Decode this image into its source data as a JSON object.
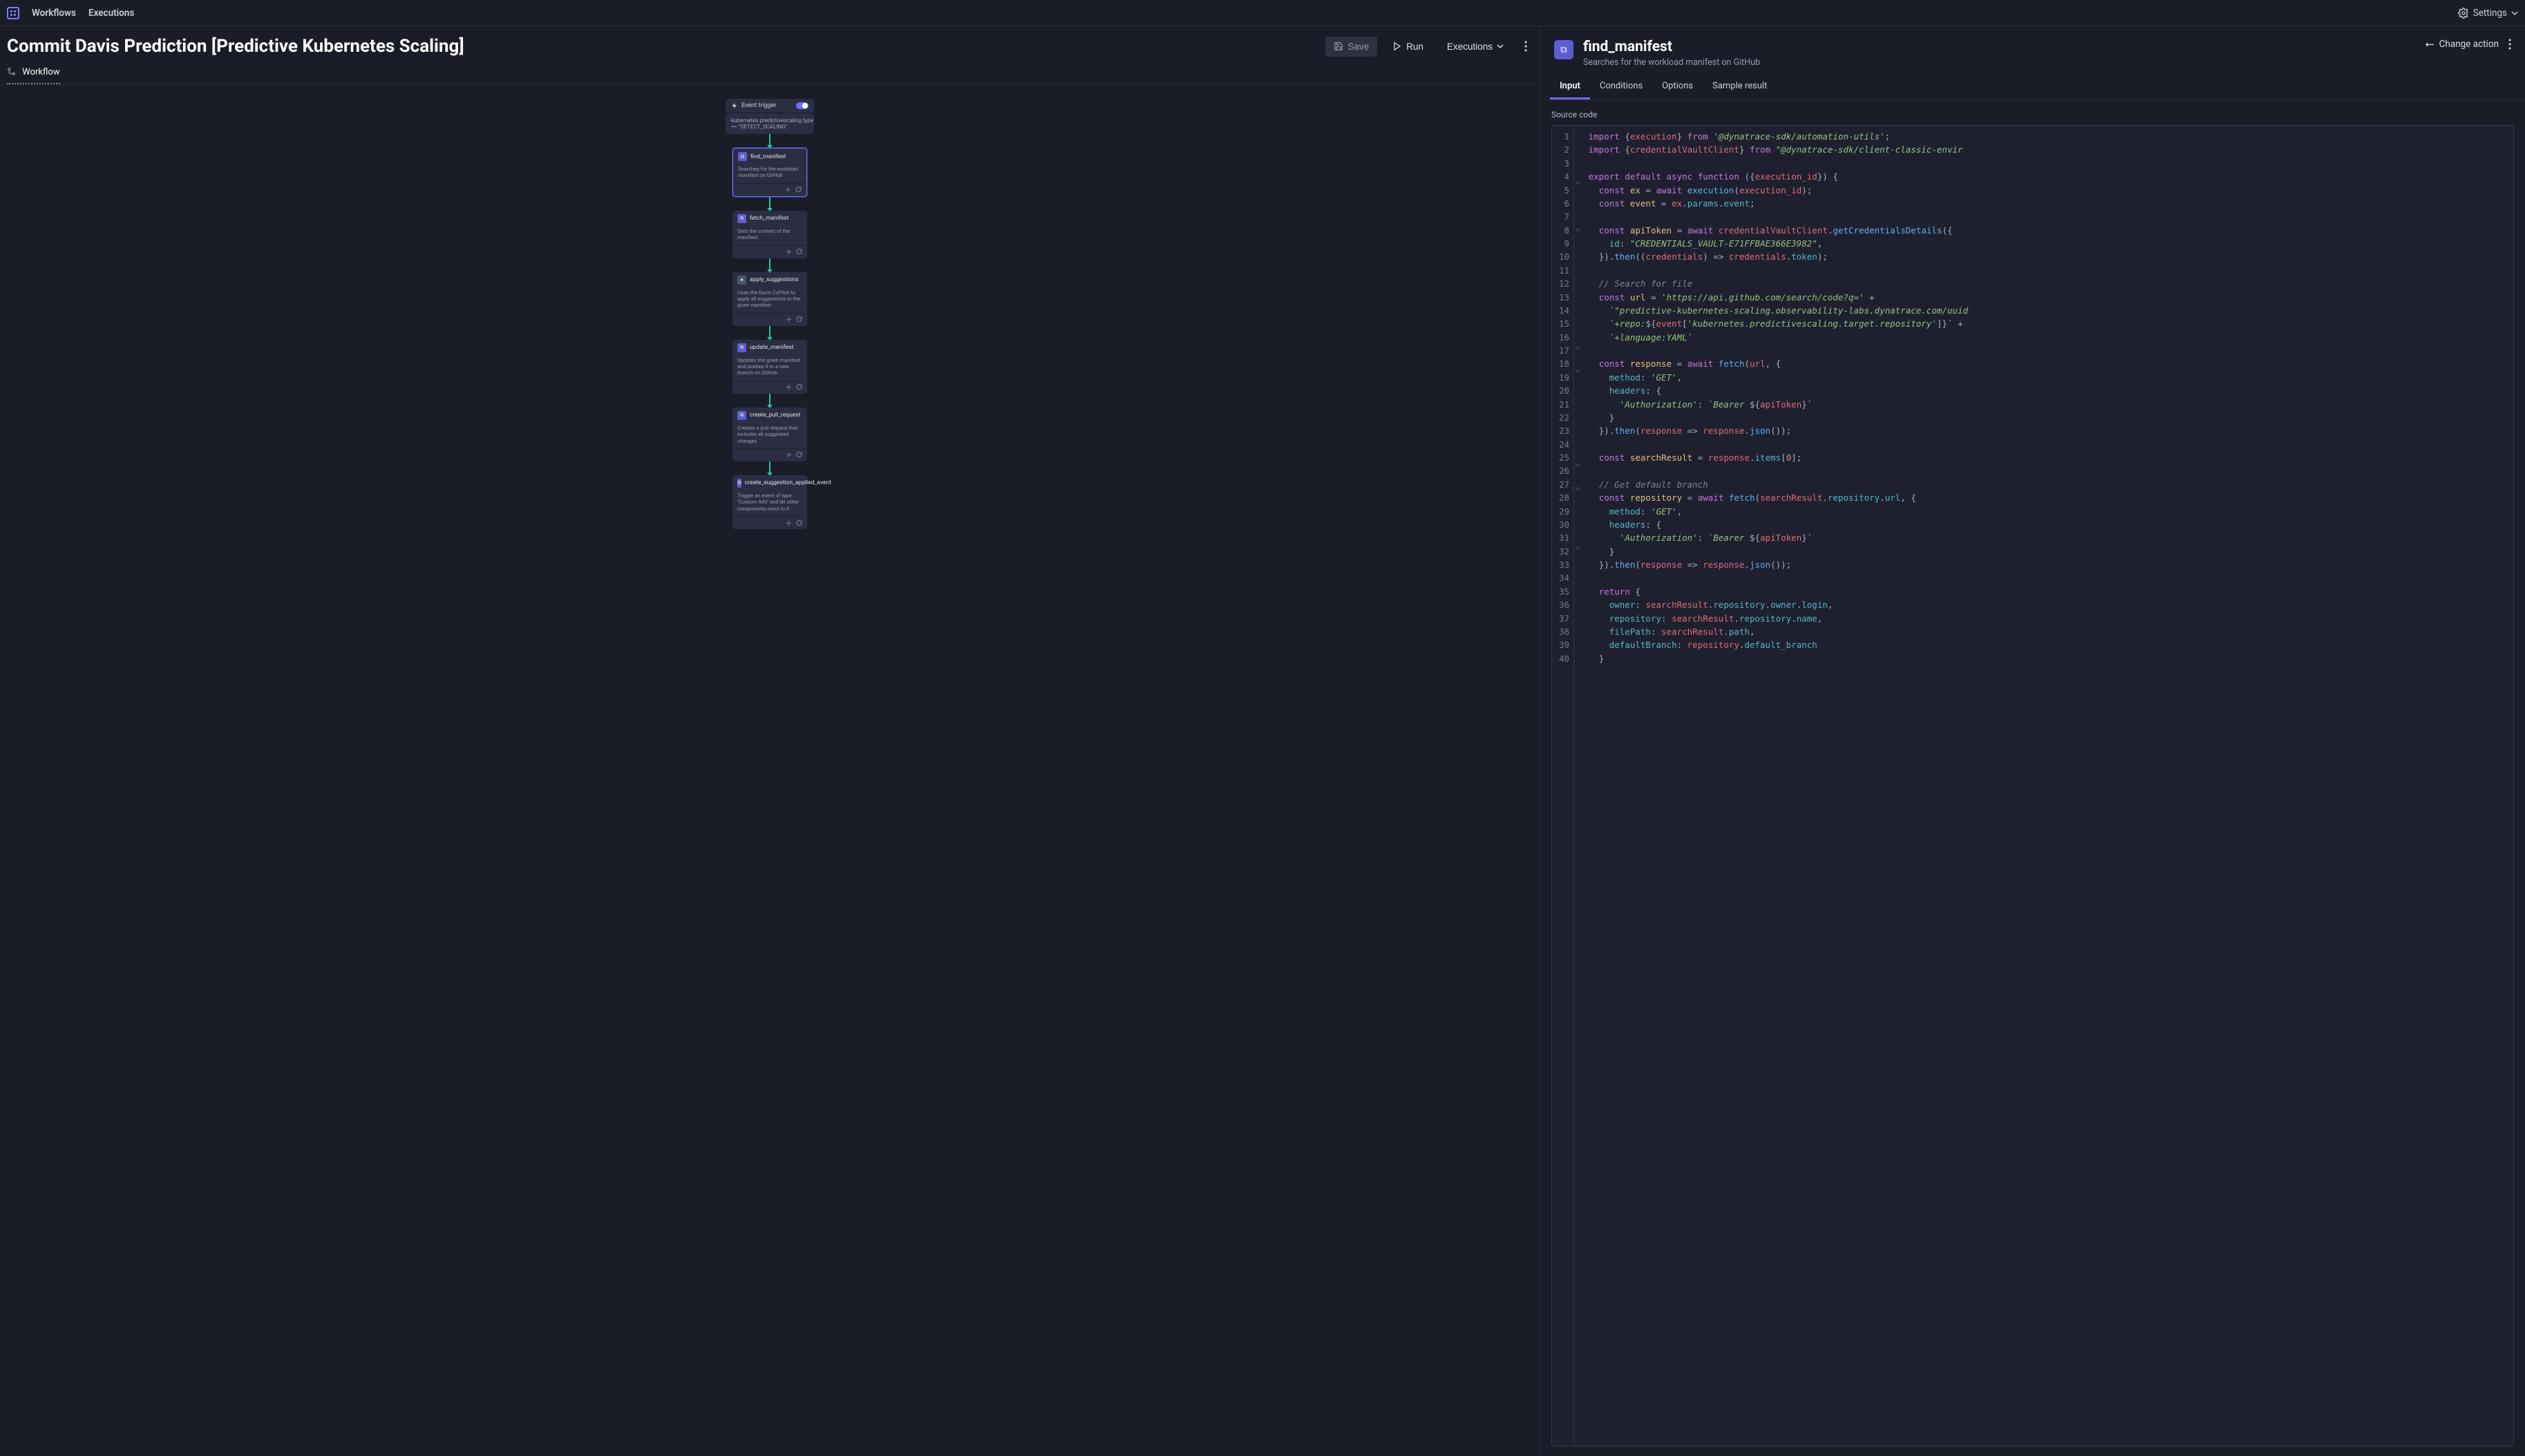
{
  "topnav": {
    "workflows": "Workflows",
    "executions": "Executions",
    "settings": "Settings"
  },
  "workflow": {
    "title": "Commit Davis Prediction [Predictive Kubernetes Scaling]",
    "save": "Save",
    "run": "Run",
    "executions": "Executions",
    "tab": "Workflow"
  },
  "nodes": {
    "trigger_label": "Event trigger",
    "trigger_desc": "kubernetes.predictivescaling.type == \"DETECT_SCALING\"",
    "n1_title": "find_manifest",
    "n1_desc": "Searches for the workload manifest on GitHub",
    "n2_title": "fetch_manifest",
    "n2_desc": "Gets the content of the manifest",
    "n3_title": "apply_suggestions",
    "n3_desc": "Uses the Davis CoPilot to apply all suggestions to the given manifest",
    "n4_title": "update_manifest",
    "n4_desc": "Updates the given manifest and pushes it to a new branch on GitHub",
    "n5_title": "create_pull_request",
    "n5_desc": "Creates a pull request that includes all suggested changes",
    "n6_title": "create_suggestion_applied_event",
    "n6_desc": "Trigger an event of type \"Custom Info\" and let other components react to it"
  },
  "right": {
    "title": "find_manifest",
    "subtitle": "Searches for the workload manifest on GitHub",
    "change_action": "Change action",
    "tabs": {
      "input": "Input",
      "conditions": "Conditions",
      "options": "Options",
      "sample": "Sample result"
    },
    "source_code": "Source code"
  },
  "code": {
    "import_execution": "import {execution} from '@dynatrace-sdk/automation-utils';",
    "import_vault": "import {credentialVaultClient} from \"@dynatrace-sdk/client-classic-envir",
    "line4": "export default async function ({execution_id}) {",
    "line5": "  const ex = await execution(execution_id);",
    "line6": "  const event = ex.params.event;",
    "line8": "  const apiToken = await credentialVaultClient.getCredentialsDetails({",
    "line9": "    id: \"CREDENTIALS_VAULT-E71FFBAE366E3982\",",
    "line10": "  }).then((credentials) => credentials.token);",
    "line12": "  // Search for file",
    "line13": "  const url = 'https://api.github.com/search/code?q=' +",
    "line14": "    `\"predictive-kubernetes-scaling.observability-labs.dynatrace.com/uuid",
    "line15": "    `+repo:${event['kubernetes.predictivescaling.target.repository']}` +",
    "line16": "    `+language:YAML`",
    "line18": "  const response = await fetch(url, {",
    "line19": "    method: 'GET',",
    "line20": "    headers: {",
    "line21": "      'Authorization': `Bearer ${apiToken}`",
    "line22": "    }",
    "line23": "  }).then(response => response.json());",
    "line25": "  const searchResult = response.items[0];",
    "line27": "  // Get default branch",
    "line28": "  const repository = await fetch(searchResult.repository.url, {",
    "line29": "    method: 'GET',",
    "line30": "    headers: {",
    "line31": "      'Authorization': `Bearer ${apiToken}`",
    "line32": "    }",
    "line33": "  }).then(response => response.json());",
    "line35": "  return {",
    "line36": "    owner: searchResult.repository.owner.login,",
    "line37": "    repository: searchResult.repository.name,",
    "line38": "    filePath: searchResult.path,",
    "line39": "    defaultBranch: repository.default_branch",
    "line40": "  }"
  }
}
